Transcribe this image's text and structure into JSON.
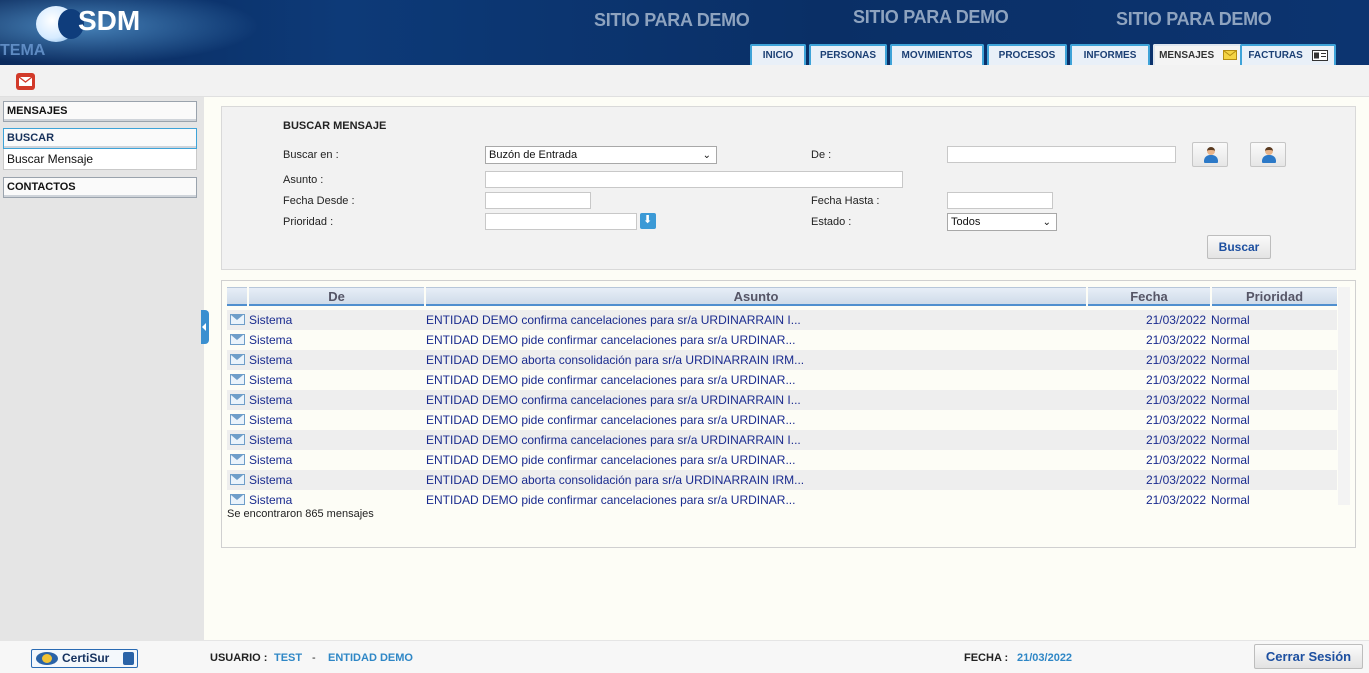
{
  "header": {
    "logo_text": "SDM",
    "tema_text": "TEMA",
    "demo_texts": [
      "SITIO PARA DEMO",
      "SITIO PARA DEMO",
      "SITIO PARA DEMO"
    ],
    "tabs": [
      {
        "label": "INICIO"
      },
      {
        "label": "PERSONAS"
      },
      {
        "label": "MOVIMIENTOS"
      },
      {
        "label": "PROCESOS"
      },
      {
        "label": "INFORMES"
      },
      {
        "label": "MENSAJES",
        "active": true,
        "icon": "envelope-icon"
      },
      {
        "label": "FACTURAS",
        "icon": "invoice-icon"
      }
    ]
  },
  "sidebar": {
    "sections": [
      {
        "label": "MENSAJES"
      },
      {
        "label": "BUSCAR",
        "items": [
          {
            "label": "Buscar Mensaje"
          }
        ]
      },
      {
        "label": "CONTACTOS"
      }
    ]
  },
  "search": {
    "title": "BUSCAR MENSAJE",
    "buscar_en_label": "Buscar en :",
    "buscar_en_value": "Buzón de Entrada",
    "de_label": "De :",
    "de_value": "",
    "asunto_label": "Asunto :",
    "asunto_value": "",
    "fecha_desde_label": "Fecha Desde :",
    "fecha_desde_value": "",
    "fecha_hasta_label": "Fecha Hasta :",
    "fecha_hasta_value": "",
    "prioridad_label": "Prioridad :",
    "prioridad_value": "",
    "estado_label": "Estado :",
    "estado_value": "Todos",
    "button_label": "Buscar"
  },
  "results": {
    "columns": [
      "De",
      "Asunto",
      "Fecha",
      "Prioridad"
    ],
    "rows": [
      {
        "de": "Sistema",
        "asunto": "ENTIDAD DEMO confirma cancelaciones para sr/a URDINARRAIN I...",
        "fecha": "21/03/2022",
        "prioridad": "Normal"
      },
      {
        "de": "Sistema",
        "asunto": "ENTIDAD DEMO pide confirmar cancelaciones para sr/a URDINAR...",
        "fecha": "21/03/2022",
        "prioridad": "Normal"
      },
      {
        "de": "Sistema",
        "asunto": "ENTIDAD DEMO aborta consolidación para sr/a URDINARRAIN IRM...",
        "fecha": "21/03/2022",
        "prioridad": "Normal"
      },
      {
        "de": "Sistema",
        "asunto": "ENTIDAD DEMO pide confirmar cancelaciones para sr/a URDINAR...",
        "fecha": "21/03/2022",
        "prioridad": "Normal"
      },
      {
        "de": "Sistema",
        "asunto": "ENTIDAD DEMO confirma cancelaciones para sr/a URDINARRAIN I...",
        "fecha": "21/03/2022",
        "prioridad": "Normal"
      },
      {
        "de": "Sistema",
        "asunto": "ENTIDAD DEMO pide confirmar cancelaciones para sr/a URDINAR...",
        "fecha": "21/03/2022",
        "prioridad": "Normal"
      },
      {
        "de": "Sistema",
        "asunto": "ENTIDAD DEMO confirma cancelaciones para sr/a URDINARRAIN I...",
        "fecha": "21/03/2022",
        "prioridad": "Normal"
      },
      {
        "de": "Sistema",
        "asunto": "ENTIDAD DEMO pide confirmar cancelaciones para sr/a URDINAR...",
        "fecha": "21/03/2022",
        "prioridad": "Normal"
      },
      {
        "de": "Sistema",
        "asunto": "ENTIDAD DEMO aborta consolidación para sr/a URDINARRAIN IRM...",
        "fecha": "21/03/2022",
        "prioridad": "Normal"
      },
      {
        "de": "Sistema",
        "asunto": "ENTIDAD DEMO pide confirmar cancelaciones para sr/a URDINAR...",
        "fecha": "21/03/2022",
        "prioridad": "Normal"
      }
    ],
    "found_text": "Se encontraron 865 mensajes"
  },
  "footer": {
    "certisur_label": "CertiSur",
    "usuario_label": "USUARIO :",
    "usuario_value": "TEST",
    "separator": "-",
    "entidad_value": "ENTIDAD DEMO",
    "fecha_label": "FECHA :",
    "fecha_value": "21/03/2022",
    "logout_label": "Cerrar Sesión"
  },
  "colors": {
    "header_bg": "#0d3a78",
    "tab_border": "#3ea3d8",
    "link_blue": "#1a2b8f",
    "accent_blue": "#2f87c6"
  }
}
